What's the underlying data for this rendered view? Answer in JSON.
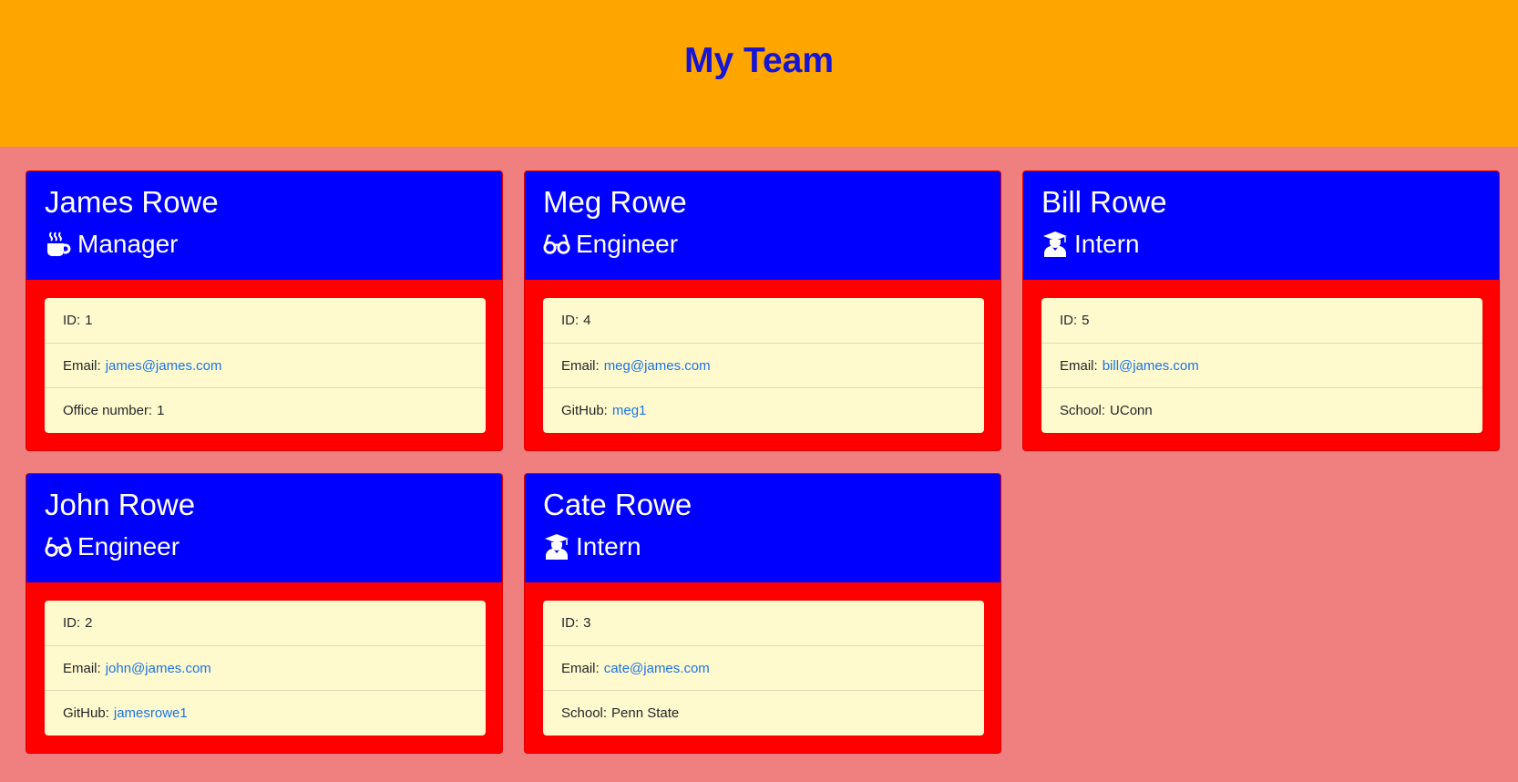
{
  "header": {
    "title": "My Team"
  },
  "team": [
    {
      "name": "James Rowe",
      "role": "Manager",
      "role_icon": "mug-icon",
      "id_label": "ID:",
      "id": "1",
      "email_label": "Email:",
      "email": "james@james.com",
      "extra_label": "Office number:",
      "extra_value": "1",
      "extra_is_link": false
    },
    {
      "name": "Meg Rowe",
      "role": "Engineer",
      "role_icon": "glasses-icon",
      "id_label": "ID:",
      "id": "4",
      "email_label": "Email:",
      "email": "meg@james.com",
      "extra_label": "GitHub:",
      "extra_value": "meg1",
      "extra_is_link": true
    },
    {
      "name": "Bill Rowe",
      "role": "Intern",
      "role_icon": "graduate-icon",
      "id_label": "ID:",
      "id": "5",
      "email_label": "Email:",
      "email": "bill@james.com",
      "extra_label": "School:",
      "extra_value": "UConn",
      "extra_is_link": false
    },
    {
      "name": "John Rowe",
      "role": "Engineer",
      "role_icon": "glasses-icon",
      "id_label": "ID:",
      "id": "2",
      "email_label": "Email:",
      "email": "john@james.com",
      "extra_label": "GitHub:",
      "extra_value": "jamesrowe1",
      "extra_is_link": true
    },
    {
      "name": "Cate Rowe",
      "role": "Intern",
      "role_icon": "graduate-icon",
      "id_label": "ID:",
      "id": "3",
      "email_label": "Email:",
      "email": "cate@james.com",
      "extra_label": "School:",
      "extra_value": "Penn State",
      "extra_is_link": false
    }
  ],
  "colors": {
    "page_bg": "#f08080",
    "banner_bg": "#ffa500",
    "title": "#1515d6",
    "card_header": "#0000ff",
    "card_body": "#ff0000",
    "info_bg": "#fffacd",
    "link": "#1a73e8"
  }
}
